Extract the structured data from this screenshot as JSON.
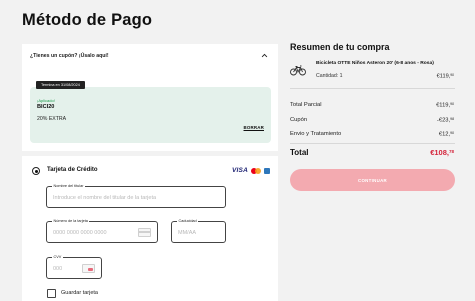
{
  "page": {
    "title": "Método de Pago"
  },
  "coupon": {
    "header": "¿Tienes un cupón? ¡Úsalo aquí!",
    "expiry": "Termina en 31/08/2024",
    "applied": "¡Aplicado!",
    "code": "BICI20",
    "description": "20% EXTRA",
    "remove_label": "BORRAR"
  },
  "payment": {
    "method_label": "Tarjeta de Crédito",
    "logos": {
      "visa": "VISA"
    },
    "fields": {
      "holder": {
        "legend": "Nombre del titular",
        "placeholder": "Introduce el nombre del titular de la tarjeta",
        "value": ""
      },
      "number": {
        "legend": "Número de la tarjeta",
        "placeholder": "0000 0000 0000 0000",
        "value": ""
      },
      "expiry": {
        "legend": "Caducidad",
        "placeholder": "MM/AA",
        "value": ""
      },
      "cvv": {
        "legend": "CVV",
        "placeholder": "000",
        "value": ""
      }
    },
    "save_card_label": "Guardar tarjeta"
  },
  "summary": {
    "title": "Resumen de tu compra",
    "product": {
      "name": "Bicicleta OTTE Niños Asteron 20' (6-8 anos - Rosa)",
      "quantity": "Cantidad: 1",
      "price_main": "€119,",
      "price_cents": "90",
      "icon": "bike-icon"
    },
    "rows": [
      {
        "label": "Total Parcial",
        "main": "€119,",
        "cents": "90"
      },
      {
        "label": "Cupón",
        "main": "-€23,",
        "cents": "98"
      },
      {
        "label": "Envio y Tratamiento",
        "main": "€12,",
        "cents": "90"
      }
    ],
    "total": {
      "label": "Total",
      "main": "€108,",
      "cents": "78"
    },
    "continue_label": "CONTINUAR"
  },
  "colors": {
    "total_red": "#d4243b",
    "coupon_bg": "#e4f1eb",
    "button_pink": "#f3aab0"
  }
}
